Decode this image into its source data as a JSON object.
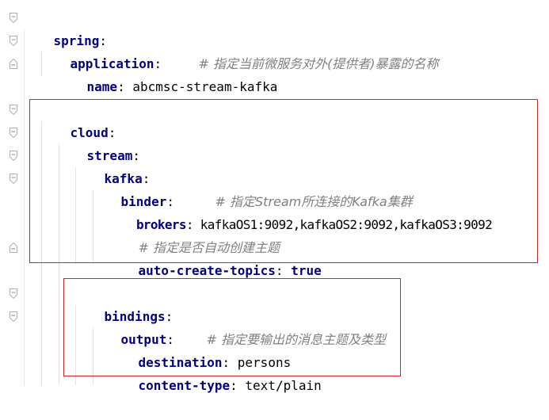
{
  "editor": {
    "lines": [
      {
        "key": "spring",
        "colon": ":",
        "value": "",
        "comment": ""
      },
      {
        "key": "application",
        "colon": ":",
        "value": "",
        "comment": "# 指定当前微服务对外(提供者)暴露的名称"
      },
      {
        "key": "name",
        "colon": ":",
        "value": "abcmsc-stream-kafka",
        "comment": ""
      },
      {
        "key": "cloud",
        "colon": ":",
        "value": "",
        "comment": ""
      },
      {
        "key": "stream",
        "colon": ":",
        "value": "",
        "comment": ""
      },
      {
        "key": "kafka",
        "colon": ":",
        "value": "",
        "comment": ""
      },
      {
        "key": "binder",
        "colon": ":",
        "value": "",
        "comment": "# 指定Stream所连接的Kafka集群"
      },
      {
        "key": "brokers",
        "colon": ":",
        "value": "kafkaOS1:9092,kafkaOS2:9092,kafkaOS3:9092",
        "comment": ""
      },
      {
        "key": "",
        "colon": "",
        "value": "",
        "comment": "# 指定是否自动创建主题"
      },
      {
        "key": "auto-create-topics",
        "colon": ":",
        "value": "true",
        "comment": ""
      },
      {
        "key": "bindings",
        "colon": ":",
        "value": "",
        "comment": ""
      },
      {
        "key": "output",
        "colon": ":",
        "value": "",
        "comment": "# 指定要输出的消息主题及类型"
      },
      {
        "key": "destination",
        "colon": ":",
        "value": "persons",
        "comment": ""
      },
      {
        "key": "content-type",
        "colon": ":",
        "value": "text/plain",
        "comment": ""
      }
    ]
  },
  "highlight": {
    "color": "#e02020"
  }
}
